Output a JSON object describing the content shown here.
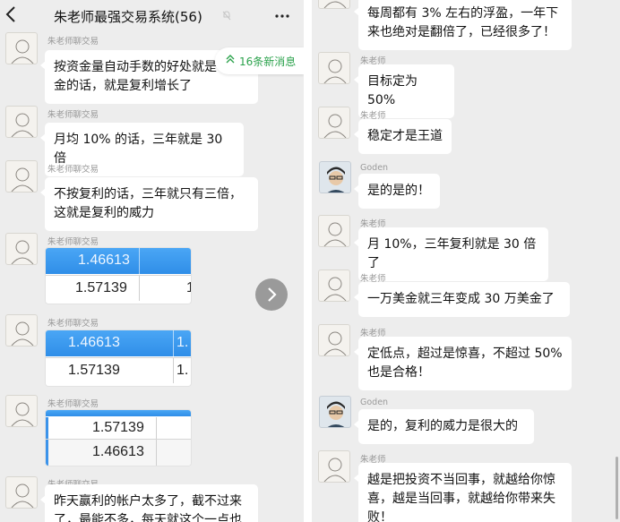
{
  "header": {
    "back_icon": "back-arrow-icon",
    "title": "朱老师最强交易系统(56)",
    "mute_icon": "mute-bell-icon",
    "more_icon": "more-dots-icon"
  },
  "new_messages_pill": {
    "label": "16条新消息",
    "icon": "double-chevron-up-icon"
  },
  "left_messages": [
    {
      "sender": "朱老师聊交易",
      "text": "按资金量自动手数的好处就是\n金的话，就是复利增长了"
    },
    {
      "sender": "朱老师聊交易",
      "text": "月均 10% 的话，三年就是 30 倍"
    },
    {
      "sender": "朱老师聊交易",
      "text": "不按复利的话，三年就只有三倍，\n这就是复利的威力"
    },
    {
      "sender": "朱老师聊交易",
      "img_rows": [
        {
          "cells": [
            "1.46613",
            ""
          ]
        },
        {
          "cells": [
            "1.57139",
            "1"
          ]
        }
      ]
    },
    {
      "sender": "朱老师聊交易",
      "img_rows": [
        {
          "cells": [
            "1.46613",
            "1."
          ]
        },
        {
          "cells": [
            "1.57139",
            "1."
          ]
        }
      ]
    },
    {
      "sender": "朱老师聊交易",
      "img_rows": [
        {
          "cells": [
            "",
            ""
          ]
        },
        {
          "cells": [
            "1.57139",
            ""
          ]
        },
        {
          "cells": [
            "1.46613",
            ""
          ]
        }
      ]
    },
    {
      "sender": "朱老师聊交易",
      "text": "昨天赢利的帐户太多了，截不过来\n了，最能不多，每天就这个一点也"
    }
  ],
  "right_messages": [
    {
      "sender": "",
      "text": "每周都有 3% 左右的浮盈，一年下\n来也绝对是翻倍了，已经很多了！"
    },
    {
      "sender": "朱老师",
      "text": "目标定为 50%"
    },
    {
      "sender": "朱老师",
      "text": "稳定才是王道"
    },
    {
      "sender": "Goden",
      "text": "是的是的！"
    },
    {
      "sender": "朱老师",
      "text": "月 10%，三年复利就是 30 倍了"
    },
    {
      "sender": "朱老师",
      "text": "一万美金就三年变成 30 万美金了"
    },
    {
      "sender": "朱老师",
      "text": "定低点，超过是惊喜，不超过 50%\n也是合格！"
    },
    {
      "sender": "Goden",
      "text": "是的，复利的威力是很大的"
    },
    {
      "sender": "朱老师",
      "text": "越是把投资不当回事，就越给你惊\n喜，越是当回事，就越给你带来失\n败！"
    }
  ],
  "colors": {
    "chat_bg": "#ededed",
    "bubble_bg": "#ffffff",
    "accent_green": "#2ba24c",
    "chart_blue": "#2f8ee8"
  }
}
